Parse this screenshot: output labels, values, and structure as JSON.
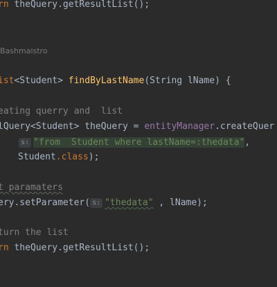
{
  "editor": {
    "language": "java",
    "theme_background": "#2b2b2b",
    "lines": {
      "l1": {
        "kw": "rn",
        "code": " theQuery.getResultList();"
      },
      "author": "Bashmaistro",
      "l3": {
        "kw": "ist",
        "type": "<Student> ",
        "method": "findByLastName",
        "params": "(String lName) {"
      },
      "l4": {
        "comment": "eating querry and  list"
      },
      "l5": {
        "prefix": "lQuery<Student> theQuery = ",
        "field": "entityManager",
        "suffix": ".createQuer"
      },
      "l6": {
        "hint": "s:",
        "str1": "\"from  Student where lastName=:thedata\"",
        "tail": ","
      },
      "l7": {
        "type": "Student",
        "kw": ".class",
        "tail": ");"
      },
      "l8": {
        "comment": "t paramaters"
      },
      "l9": {
        "code": "ery.setParameter(",
        "hint": "s:",
        "str": "\"thedata\"",
        "tail": " , lName);"
      },
      "l10": {
        "comment": "turn the list"
      },
      "l11": {
        "kw": "rn",
        "code": " theQuery.getResultList();"
      }
    }
  }
}
